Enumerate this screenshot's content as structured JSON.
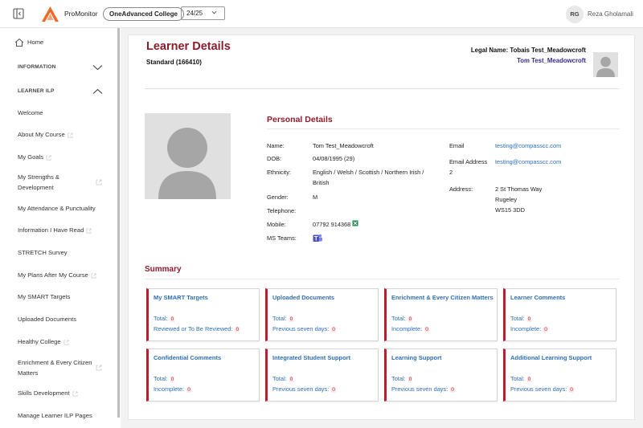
{
  "topbar": {
    "brand": "ProMonitor",
    "college": "OneAdvanced College",
    "year": "24/25",
    "user_initials": "RG",
    "user_name": "Reza Gholamali"
  },
  "sidebar": {
    "home": "Home",
    "section_information": "INFORMATION",
    "section_ilp": "LEARNER ILP",
    "items": [
      {
        "label": "Welcome"
      },
      {
        "label": "About My Course"
      },
      {
        "label": "My Goals"
      },
      {
        "label": "My Strengths &"
      },
      {
        "label": "Development"
      },
      {
        "label": "My Attendance & Punctuality"
      },
      {
        "label": "Information I Have Read"
      },
      {
        "label": "STRETCH Survey"
      },
      {
        "label": "My Plans After My Course"
      },
      {
        "label": "My SMART Targets"
      },
      {
        "label": "Uploaded Documents"
      },
      {
        "label": "Healthy College"
      },
      {
        "label": "Enrichment & Every Citizen"
      },
      {
        "label": "Matters"
      },
      {
        "label": "Skills Development"
      },
      {
        "label": "Manage Learner ILP Pages"
      }
    ]
  },
  "header": {
    "title": "Learner Details",
    "subtitle": "Standard (166410)",
    "legal_name": "Legal Name: Tobais Test_Meadowcroft",
    "display_name": "Tom Test_Meadowcroft"
  },
  "personal": {
    "title": "Personal Details",
    "name_label": "Name:",
    "name": "Tom Test_Meadowcroft",
    "dob_label": "DOB:",
    "dob": "04/08/1995 (29)",
    "ethnicity_label": "Ethnicity:",
    "ethnicity_line1": "English / Welsh / Scottish / Northern Irish /",
    "ethnicity_line2": "British",
    "gender_label": "Gender:",
    "gender": "M",
    "telephone_label": "Telephone:",
    "mobile_label": "Mobile:",
    "mobile": "07792 914368",
    "teams_label": "MS Teams:",
    "email_label": "Email",
    "email": "testing@compasscc.com",
    "email2_label_line1": "Email Address",
    "email2_label_line2": "2",
    "email2": "testing@compasscc.com",
    "address_label": "Address:",
    "address_line1": "2 St Thomas Way",
    "address_line2": "Rugeley",
    "address_line3": "WS15 3DD"
  },
  "summary": {
    "title": "Summary",
    "cards": [
      {
        "title": "My SMART Targets",
        "row1": "Total:",
        "v1": "0",
        "row2": "Reviewed or To Be Reviewed:",
        "v2": "0"
      },
      {
        "title": "Uploaded Documents",
        "row1": "Total:",
        "v1": "0",
        "row2": "Previous seven days:",
        "v2": "0"
      },
      {
        "title": "Enrichment & Every Citizen Matters",
        "row1": "Total:",
        "v1": "0",
        "row2": "Incomplete:",
        "v2": "0"
      },
      {
        "title": "Learner Comments",
        "row1": "Total:",
        "v1": "0",
        "row2": "Incomplete:",
        "v2": "0"
      },
      {
        "title": "Confidential Comments",
        "row1": "Total:",
        "v1": "0",
        "row2": "Incomplete:",
        "v2": "0"
      },
      {
        "title": "Integrated Student Support",
        "row1": "Total:",
        "v1": "0",
        "row2": "Previous seven days:",
        "v2": "0"
      },
      {
        "title": "Learning Support",
        "row1": "Total:",
        "v1": "0",
        "row2": "Previous seven days:",
        "v2": "0"
      },
      {
        "title": "Additional Learning Support",
        "row1": "Total:",
        "v1": "0",
        "row2": "Previous seven days:",
        "v2": "0"
      }
    ]
  },
  "colors": {
    "accent": "#8a1d2e",
    "link": "#2f6fb5",
    "card_border": "#b71f33"
  }
}
